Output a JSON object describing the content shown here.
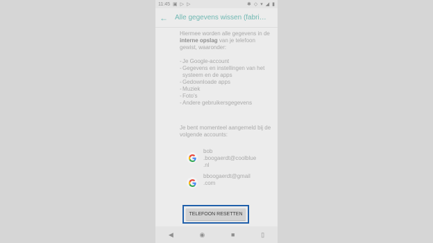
{
  "status": {
    "time": "11:45"
  },
  "appbar": {
    "title": "Alle gegevens wissen (fabri…"
  },
  "intro": {
    "part1": "Hiermee worden alle gegevens in de ",
    "bold": "interne opslag",
    "part2": " van je telefoon gewist, waaronder:"
  },
  "items": [
    "Je Google-account",
    "Gegevens en instellingen van het systeem en de apps",
    "Gedownloade apps",
    "Muziek",
    "Foto's",
    "Andere gebruikersgegevens"
  ],
  "signed_in_text": "Je bent momenteel aangemeld bij de volgende accounts:",
  "accounts": [
    {
      "line1": "bob",
      "line2": ".boogaerdt@coolblue",
      "line3": ".nl"
    },
    {
      "line1": "bboogaerdt@gmail",
      "line2": ".com"
    }
  ],
  "reset_button": "TELEFOON RESETTEN",
  "icons": {
    "back": "back-arrow-icon",
    "google": "google-g-icon"
  },
  "colors": {
    "accent": "#6fb8b2",
    "highlight_border": "#1f5faa"
  }
}
